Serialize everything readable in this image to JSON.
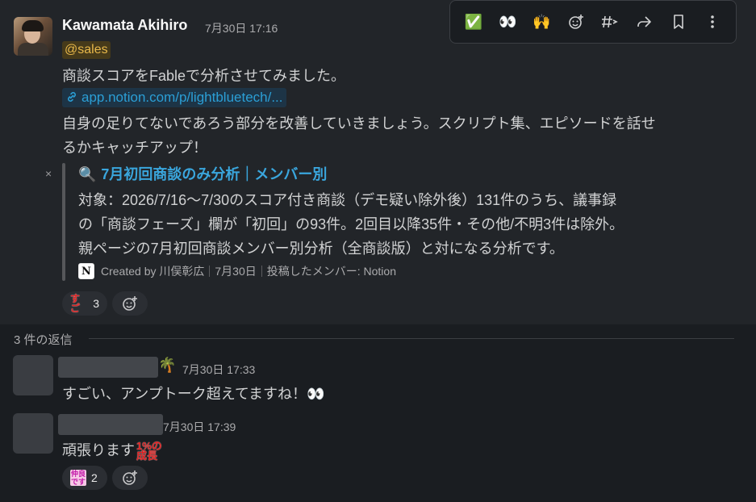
{
  "toolbar": {
    "items": [
      {
        "icon": "check-icon",
        "glyph": "✅"
      },
      {
        "icon": "eyes-icon",
        "glyph": "👀"
      },
      {
        "icon": "raised-hands-icon",
        "glyph": "🙌"
      },
      {
        "icon": "add-reaction-icon"
      },
      {
        "icon": "channel-hash-icon"
      },
      {
        "icon": "forward-icon"
      },
      {
        "icon": "bookmark-icon"
      },
      {
        "icon": "more-icon"
      }
    ]
  },
  "message": {
    "author": "Kawamata Akihiro",
    "timestamp": "7月30日 17:16",
    "mention": "@sales",
    "line1": "商談スコアをFableで分析させてみました。",
    "link": "app.notion.com/p/lightbluetech/...",
    "line2": "自身の足りてないであろう部分を改善していきましょう。スクリプト集、エピソードを話せ",
    "line3": "るかキャッチアップ！",
    "unfurl": {
      "close": "×",
      "title": "7月初回商談のみ分析｜メンバー別",
      "body1": "対象：2026/7/16〜7/30のスコア付き商談（デモ疑い除外後）131件のうち、議事録",
      "body2": "の「商談フェーズ」欄が「初回」の93件。2回目以降35件・その他/不明3件は除外。",
      "body3": "親ページの7月初回商談メンバー別分析（全商談版）と対になる分析です。",
      "created_by": "Created by 川俣彰広",
      "date": "7月30日",
      "posted_by": "投稿したメンバー: Notion"
    },
    "reaction": {
      "emoji": "すご",
      "count": "3"
    }
  },
  "replies": {
    "header": "3 件の返信",
    "items": [
      {
        "emoji": "🌴",
        "timestamp": "7月30日 17:33",
        "text": "すごい、アンプトーク超えてますね！👀"
      },
      {
        "timestamp": "7月30日 17:39",
        "text": "頑張ります",
        "stamp": "1%の成長",
        "reaction": {
          "emoji": "仲良です",
          "count": "2"
        }
      }
    ]
  }
}
